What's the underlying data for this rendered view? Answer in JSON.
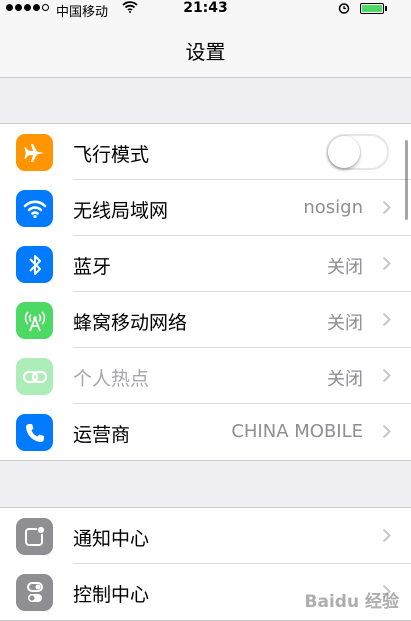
{
  "status_bar": {
    "carrier": "中国移动",
    "time": "21:43",
    "battery_percent": 100,
    "signal_bars": 4
  },
  "nav": {
    "title": "设置"
  },
  "group1": [
    {
      "label": "飞行模式",
      "icon": "airplane-icon",
      "color": "#ff9500",
      "toggle": false
    },
    {
      "label": "无线局域网",
      "icon": "wifi-icon",
      "color": "#007aff",
      "value": "nosign"
    },
    {
      "label": "蓝牙",
      "icon": "bluetooth-icon",
      "color": "#007aff",
      "value": "关闭"
    },
    {
      "label": "蜂窝移动网络",
      "icon": "cellular-icon",
      "color": "#4cd964",
      "value": "关闭"
    },
    {
      "label": "个人热点",
      "icon": "hotspot-icon",
      "color": "#4cd964",
      "value": "关闭",
      "disabled": true
    },
    {
      "label": "运营商",
      "icon": "phone-icon",
      "color": "#007aff",
      "value": "CHINA MOBILE"
    }
  ],
  "group2": [
    {
      "label": "通知中心",
      "icon": "notification-center-icon",
      "color": "#8e8e93"
    },
    {
      "label": "控制中心",
      "icon": "control-center-icon",
      "color": "#8e8e93"
    }
  ],
  "watermark": "Baidu 经验"
}
